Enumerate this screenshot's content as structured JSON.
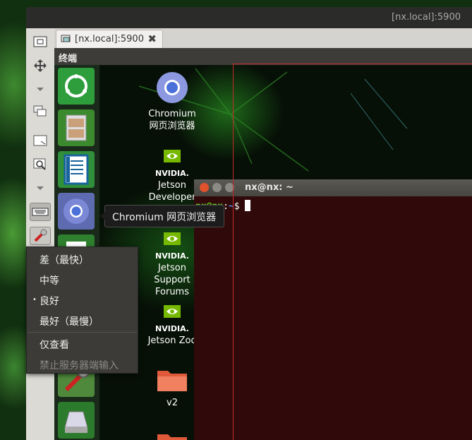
{
  "window": {
    "title": "[nx.local]:5900"
  },
  "tab": {
    "label": "[nx.local]:5900",
    "close_glyph": "✖"
  },
  "remote": {
    "topbar_title": "终端",
    "desktop_icons": [
      {
        "label_lines": [
          "Chromium",
          "网页浏览器"
        ]
      },
      {
        "brand": "NVIDIA.",
        "label_lines": [
          "Jetson",
          "Developer"
        ]
      },
      {
        "brand": "NVIDIA.",
        "label_lines": [
          "Jetson",
          "Support",
          "Forums"
        ]
      },
      {
        "brand": "NVIDIA.",
        "label_lines": [
          "Jetson Zoo"
        ]
      },
      {
        "label_lines": [
          "v2"
        ]
      }
    ],
    "tooltip": "Chromium 网页浏览器",
    "terminal": {
      "title": "nx@nx: ~",
      "prompt_user": "nx@nx",
      "prompt_sep": ":",
      "prompt_path": "~",
      "prompt_end": "$"
    }
  },
  "quality_menu": {
    "items": [
      {
        "label": "差（最快）",
        "selected": false
      },
      {
        "label": "中等",
        "selected": false
      },
      {
        "label": "良好",
        "selected": true
      },
      {
        "label": "最好（最慢）",
        "selected": false
      }
    ],
    "view_only": "仅查看",
    "disable_input": "禁止服务器端输入",
    "selected_marker": "•"
  },
  "colors": {
    "prompt_user": "#5ed41e",
    "prompt_path": "#4d8ef0",
    "terminal_bg": "#300a0a",
    "menu_bg": "#3c3b37",
    "red_frame": "#c42a2a"
  },
  "icons": [
    "screenshot-icon",
    "move-icon",
    "chevron-down-icon",
    "windows-icon",
    "resize-icon",
    "zoom-icon",
    "keyboard-icon",
    "tools-icon",
    "remmina-tab-icon",
    "close-icon"
  ]
}
